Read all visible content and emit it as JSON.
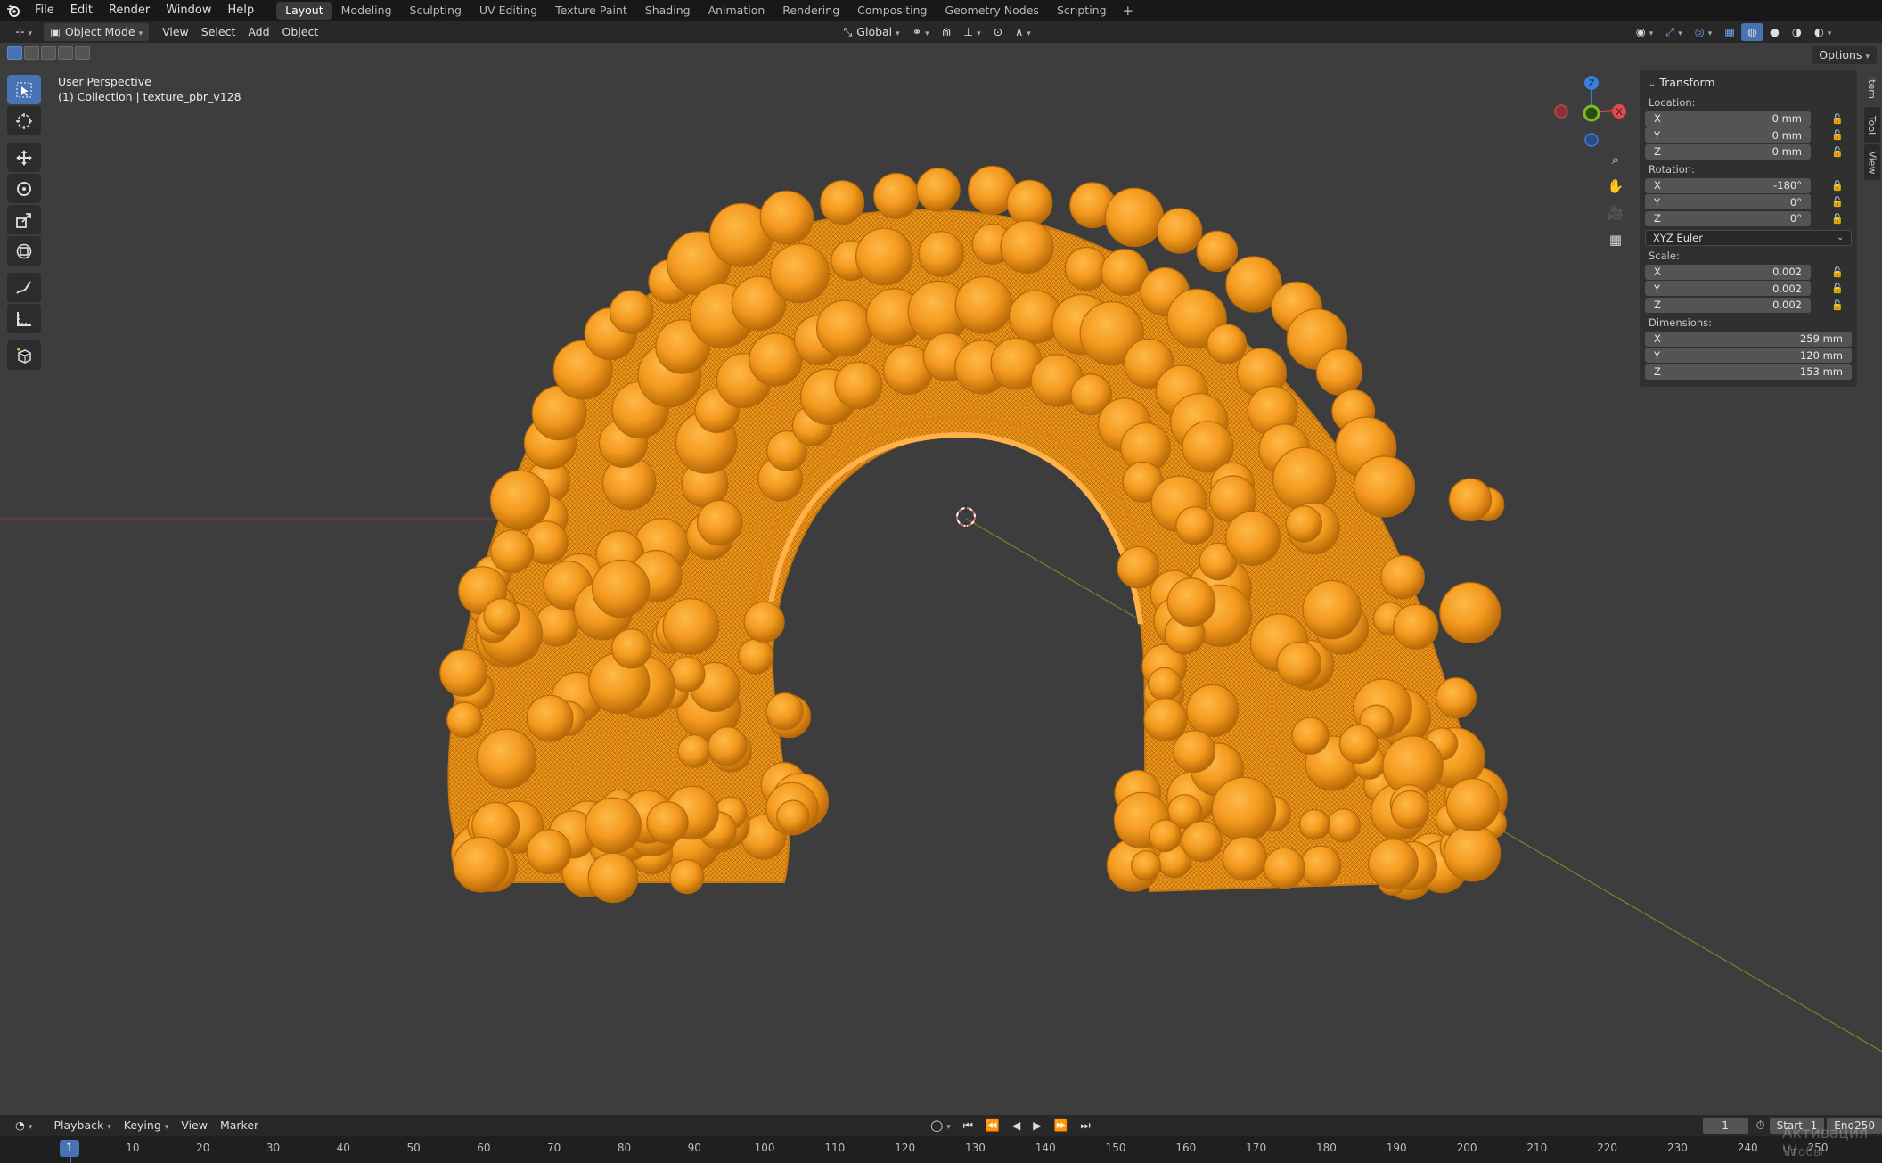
{
  "menubar": {
    "items": [
      "File",
      "Edit",
      "Render",
      "Window",
      "Help"
    ],
    "workspaces": [
      "Layout",
      "Modeling",
      "Sculpting",
      "UV Editing",
      "Texture Paint",
      "Shading",
      "Animation",
      "Rendering",
      "Compositing",
      "Geometry Nodes",
      "Scripting"
    ],
    "add_label": "+"
  },
  "viewport_header": {
    "mode": "Object Mode",
    "menus": [
      "View",
      "Select",
      "Add",
      "Object"
    ],
    "orientation": "Global"
  },
  "options_label": "Options",
  "overlay": {
    "perspective": "User Perspective",
    "collection": "(1) Collection | texture_pbr_v128"
  },
  "gizmo": {
    "z": "Z",
    "x": "X",
    "y": "Y"
  },
  "npanel": {
    "title": "Transform",
    "location_label": "Location:",
    "location": [
      {
        "axis": "X",
        "value": "0 mm"
      },
      {
        "axis": "Y",
        "value": "0 mm"
      },
      {
        "axis": "Z",
        "value": "0 mm"
      }
    ],
    "rotation_label": "Rotation:",
    "rotation": [
      {
        "axis": "X",
        "value": "-180°"
      },
      {
        "axis": "Y",
        "value": "0°"
      },
      {
        "axis": "Z",
        "value": "0°"
      }
    ],
    "rotation_mode": "XYZ Euler",
    "scale_label": "Scale:",
    "scale": [
      {
        "axis": "X",
        "value": "0.002"
      },
      {
        "axis": "Y",
        "value": "0.002"
      },
      {
        "axis": "Z",
        "value": "0.002"
      }
    ],
    "dimensions_label": "Dimensions:",
    "dimensions": [
      {
        "axis": "X",
        "value": "259 mm"
      },
      {
        "axis": "Y",
        "value": "120 mm"
      },
      {
        "axis": "Z",
        "value": "153 mm"
      }
    ],
    "tabs": [
      "Item",
      "Tool",
      "View"
    ]
  },
  "timeline": {
    "menus": [
      "Playback",
      "Keying",
      "View",
      "Marker"
    ],
    "current_frame": "1",
    "start_label": "Start",
    "start_value": "1",
    "end_label": "End",
    "end_value": "250",
    "ticks": [
      "1",
      "10",
      "20",
      "30",
      "40",
      "50",
      "60",
      "70",
      "80",
      "90",
      "100",
      "110",
      "120",
      "130",
      "140",
      "150",
      "160",
      "170",
      "180",
      "190",
      "200",
      "210",
      "220",
      "230",
      "240",
      "250"
    ]
  },
  "watermark": {
    "line1": "Активация W",
    "line2": "Чтобы активиро"
  },
  "colors": {
    "accent": "#4772b3",
    "object": "#f39a1e",
    "axis_x": "#e0494f",
    "axis_y": "#7cbb26",
    "axis_z": "#3b7ddd"
  }
}
